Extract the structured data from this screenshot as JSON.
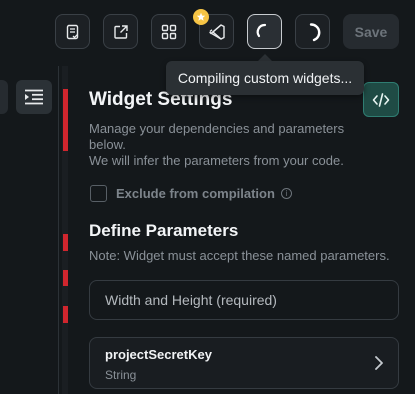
{
  "toolbar": {
    "buttons": [
      {
        "icon": "document-check-icon"
      },
      {
        "icon": "open-external-icon"
      },
      {
        "icon": "grid-icon"
      },
      {
        "icon": "vscode-icon",
        "badge": "star-icon"
      },
      {
        "icon": "loading-spinner-icon",
        "active": true
      },
      {
        "icon": "refresh-spinner-icon"
      }
    ],
    "save_label": "Save"
  },
  "tooltip": {
    "text": "Compiling custom widgets..."
  },
  "widget_settings": {
    "title": "Widget Settings",
    "description_lines": [
      "Manage your dependencies and parameters",
      "below.",
      "We will infer the parameters from your code."
    ],
    "exclude_label": "Exclude from compilation",
    "exclude_checked": false
  },
  "parameters": {
    "title": "Define Parameters",
    "note": "Note: Widget must accept these named parameters.",
    "input_placeholder": "Width and Height (required)",
    "items": [
      {
        "name": "projectSecretKey",
        "type": "String"
      }
    ]
  },
  "colors": {
    "background": "#14181b",
    "accent_teal": "#1f4b45",
    "error_red": "#d0262e",
    "badge_yellow": "#f6c445"
  }
}
